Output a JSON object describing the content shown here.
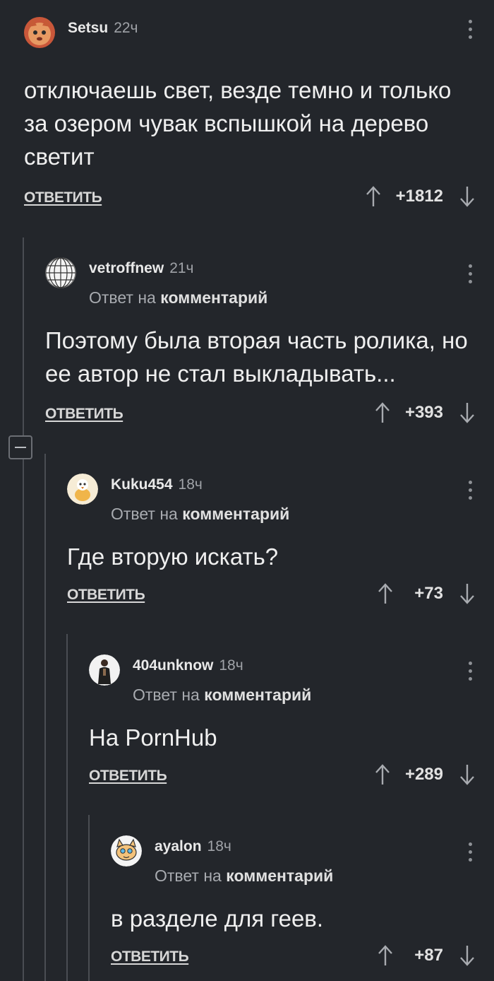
{
  "comments": [
    {
      "username": "Setsu",
      "time": "22ч",
      "reply_prefix": "",
      "reply_target": "",
      "text": "отключаешь свет, везде темно и только за озером чувак вспышкой на дерево светит",
      "reply_label": "ОТВЕТИТЬ",
      "score": "+1812",
      "avatar": "cat-avatar"
    },
    {
      "username": "vetroffnew",
      "time": "21ч",
      "reply_prefix": "Ответ на ",
      "reply_target": "комментарий",
      "text": "Поэтому была вторая часть ролика, но ее автор не стал выкладывать...",
      "reply_label": "ОТВЕТИТЬ",
      "score": "+393",
      "avatar": "globe-avatar"
    },
    {
      "username": "Kuku454",
      "time": "18ч",
      "reply_prefix": "Ответ на ",
      "reply_target": "комментарий",
      "text": "Где вторую искать?",
      "reply_label": "ОТВЕТИТЬ",
      "score": "+73",
      "avatar": "bird-avatar"
    },
    {
      "username": "404unknow",
      "time": "18ч",
      "reply_prefix": "Ответ на ",
      "reply_target": "комментарий",
      "text": "На PornHub",
      "reply_label": "ОТВЕТИТЬ",
      "score": "+289",
      "avatar": "person-avatar"
    },
    {
      "username": "ayalon",
      "time": "18ч",
      "reply_prefix": "Ответ на ",
      "reply_target": "комментарий",
      "text": "в разделе для геев.",
      "reply_label": "ОТВЕТИТЬ",
      "score": "+87",
      "avatar": "cartoon-cat-avatar"
    }
  ],
  "colors": {
    "background": "#23262b",
    "thread_line": "#4a4d53",
    "text": "#efefef",
    "muted": "#a8abb0"
  }
}
